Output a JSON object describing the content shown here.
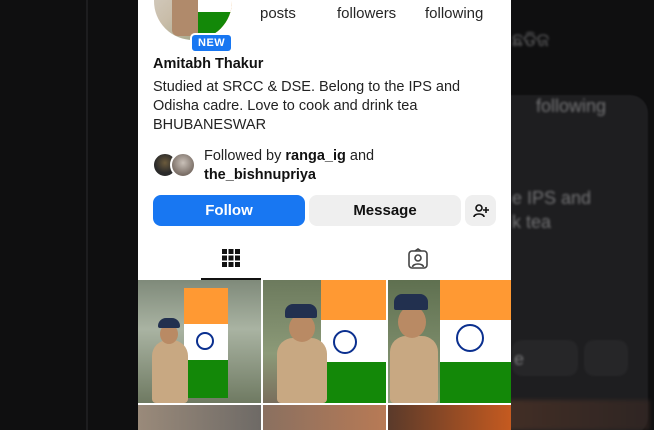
{
  "background": {
    "texts": [
      {
        "id": "bg-odia",
        "text": "ଛଡିଜ"
      },
      {
        "id": "bg-following",
        "text": "following"
      },
      {
        "id": "bg-ips",
        "text": "e IPS and"
      },
      {
        "id": "bg-tea",
        "text": "k tea"
      },
      {
        "id": "bg-e",
        "text": "e"
      }
    ]
  },
  "profile": {
    "badge": "NEW",
    "stats": {
      "posts_label": "posts",
      "followers_label": "followers",
      "following_label": "following"
    },
    "name": "Amitabh Thakur",
    "bio_lines": [
      "Studied at SRCC & DSE. Belong to the IPS and",
      "Odisha cadre. Love to cook and drink tea",
      "BHUBANESWAR"
    ],
    "followed_by_prefix": "Followed by",
    "followed_by_user1": "ranga_ig",
    "followed_by_and": "and",
    "followed_by_user2": "the_bishnupriya"
  },
  "actions": {
    "follow_label": "Follow",
    "message_label": "Message",
    "add_user_icon": "person-plus-icon"
  },
  "tabs": [
    {
      "name": "posts-grid",
      "icon": "grid-icon",
      "active": true
    },
    {
      "name": "tagged",
      "icon": "tagged-person-icon",
      "active": false
    }
  ],
  "colors": {
    "accent": "#1877f2",
    "badge": "#1877f2",
    "button_secondary": "#efefef"
  }
}
